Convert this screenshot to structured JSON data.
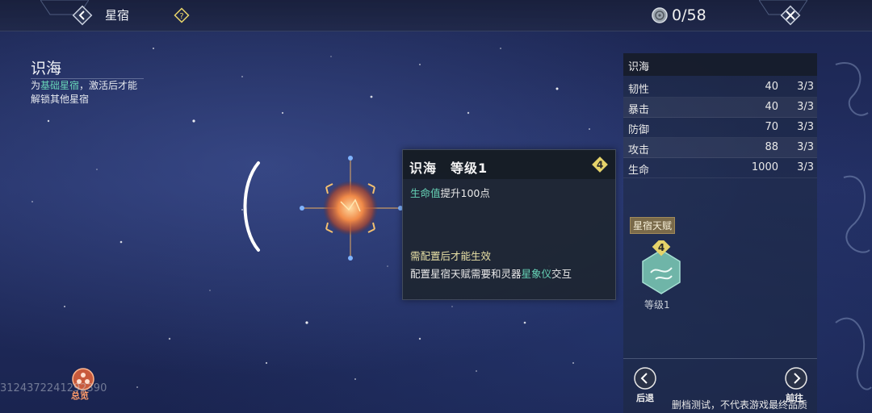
{
  "header": {
    "title": "星宿",
    "counter": "0/58"
  },
  "intro": {
    "title": "识海",
    "desc_prefix": "为",
    "desc_highlight": "基础星宿",
    "desc_suffix": "，激活后才能解锁其他星宿"
  },
  "tooltip": {
    "title": "识海　等级1",
    "badge": "4",
    "effect_highlight": "生命值",
    "effect_text": "提升100点",
    "requirement": "需配置后才能生效",
    "hint_prefix": "配置星宿天赋需要和灵器",
    "hint_highlight": "星象仪",
    "hint_suffix": "交互"
  },
  "stats_panel": {
    "title": "识海",
    "rows": [
      {
        "name": "韧性",
        "value": "40",
        "level": "3/3"
      },
      {
        "name": "暴击",
        "value": "40",
        "level": "3/3"
      },
      {
        "name": "防御",
        "value": "70",
        "level": "3/3"
      },
      {
        "name": "攻击",
        "value": "88",
        "level": "3/3"
      },
      {
        "name": "生命",
        "value": "1000",
        "level": "3/3"
      }
    ],
    "talent_label": "星宿天赋",
    "talent_badge": "4",
    "talent_level": "等级1",
    "back_label": "后退",
    "forward_label": "前往"
  },
  "footer": {
    "overview_label": "总览",
    "player_id": "3124372241292390",
    "disclaimer": "删档测试，不代表游戏最终品质"
  },
  "colors": {
    "highlight_green": "#67d3b7",
    "requirement_yellow": "#e9e1a6",
    "badge_gold": "#e6d36a",
    "overview_orange": "#ff9c6a"
  }
}
